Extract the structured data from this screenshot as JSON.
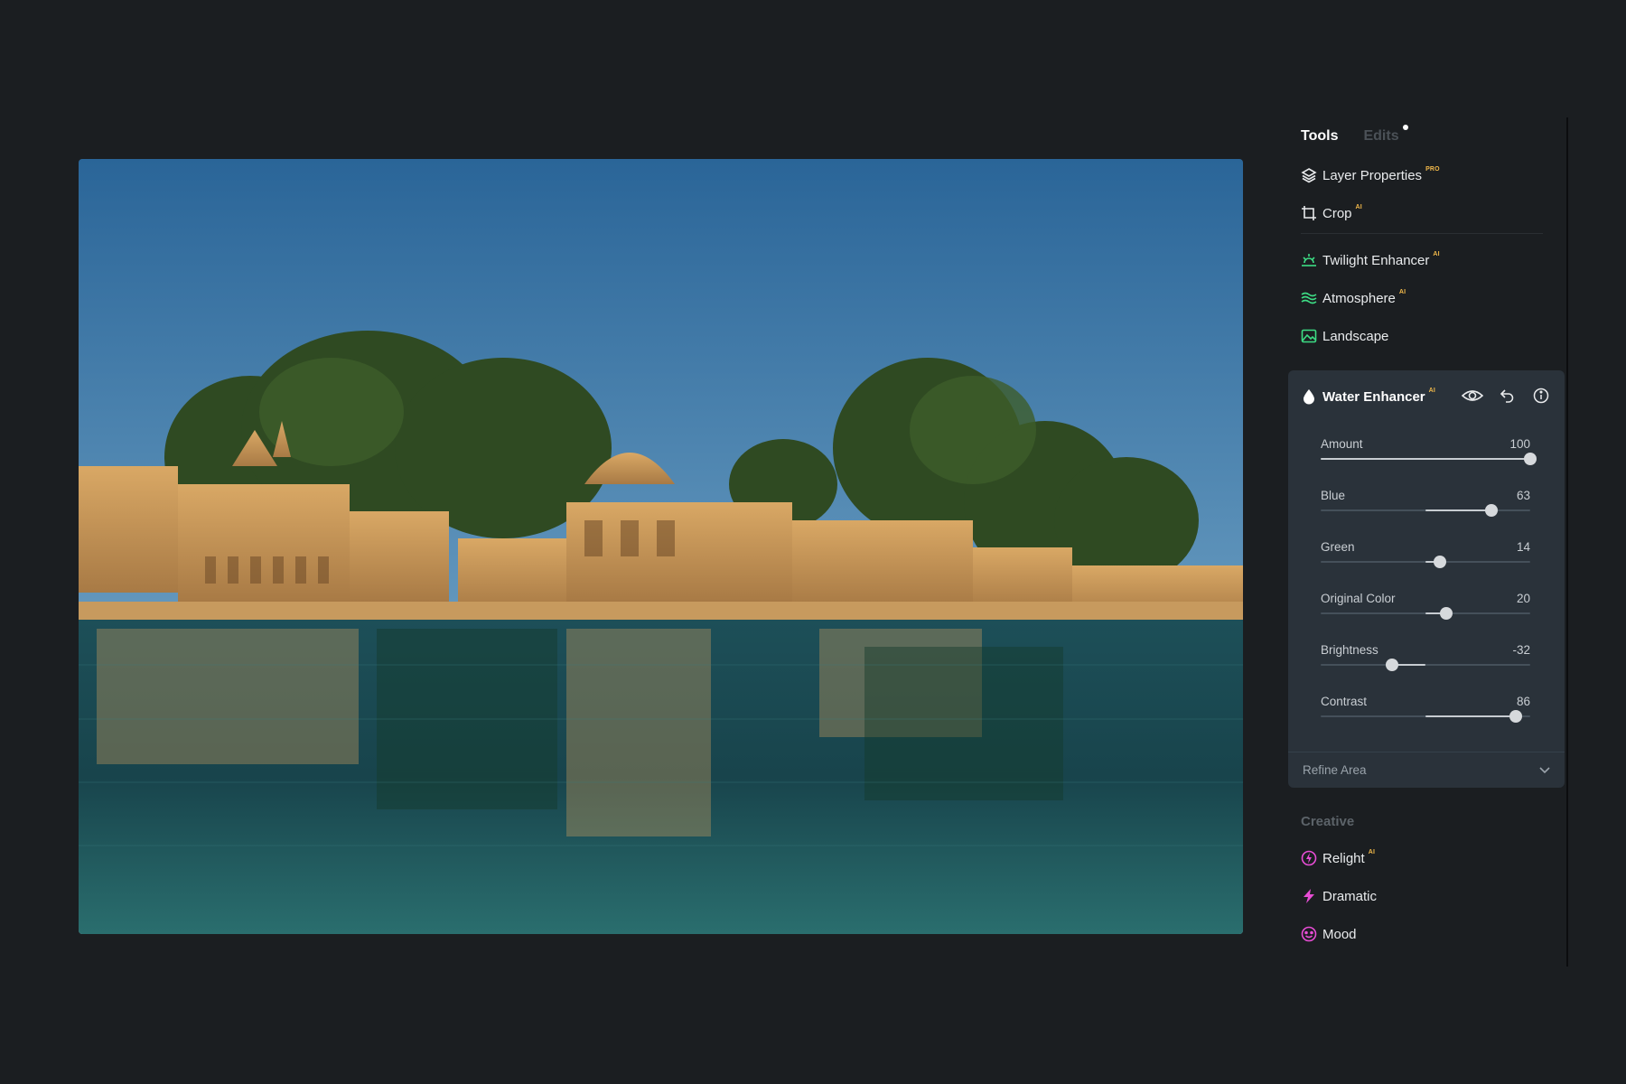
{
  "tabs": {
    "tools": "Tools",
    "edits": "Edits"
  },
  "tools": [
    {
      "label": "Layer Properties",
      "badge": "PRO",
      "icon": "layers-icon"
    },
    {
      "label": "Crop",
      "badge": "AI",
      "icon": "crop-icon"
    },
    {
      "label": "Twilight Enhancer",
      "badge": "AI",
      "icon": "sunrise-icon"
    },
    {
      "label": "Atmosphere",
      "badge": "AI",
      "icon": "waves-icon"
    },
    {
      "label": "Landscape",
      "badge": "",
      "icon": "image-icon"
    }
  ],
  "water_enhancer": {
    "title": "Water Enhancer",
    "badge": "AI",
    "icons": [
      "eye-icon",
      "undo-icon",
      "info-icon"
    ],
    "sliders": [
      {
        "label": "Amount",
        "value": "100",
        "min": 0,
        "max": 100,
        "num": 100
      },
      {
        "label": "Blue",
        "value": "63",
        "min": -100,
        "max": 100,
        "num": 63
      },
      {
        "label": "Green",
        "value": "14",
        "min": -100,
        "max": 100,
        "num": 14
      },
      {
        "label": "Original Color",
        "value": "20",
        "min": -100,
        "max": 100,
        "num": 20
      },
      {
        "label": "Brightness",
        "value": "-32",
        "min": -100,
        "max": 100,
        "num": -32
      },
      {
        "label": "Contrast",
        "value": "86",
        "min": -100,
        "max": 100,
        "num": 86
      }
    ],
    "refine_label": "Refine Area"
  },
  "creative": {
    "title": "Creative",
    "items": [
      {
        "label": "Relight",
        "badge": "AI",
        "icon": "relight-icon"
      },
      {
        "label": "Dramatic",
        "badge": "",
        "icon": "lightning-icon"
      },
      {
        "label": "Mood",
        "badge": "",
        "icon": "mood-icon"
      }
    ]
  },
  "colors": {
    "panel_bg": "#1b1e21",
    "card_bg": "#2a323a",
    "badge": "#f1b84a",
    "icon_green": "#3ddc84",
    "icon_pink": "#e84dd5"
  }
}
